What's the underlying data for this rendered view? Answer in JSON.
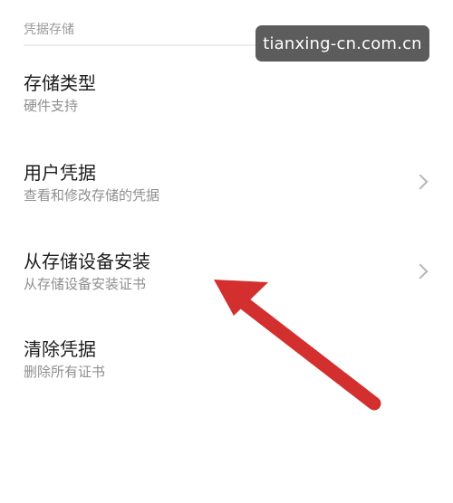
{
  "section": {
    "header": "凭据存储"
  },
  "rows": [
    {
      "title": "存储类型",
      "subtitle": "硬件支持",
      "has_chevron": false
    },
    {
      "title": "用户凭据",
      "subtitle": "查看和修改存储的凭据",
      "has_chevron": true
    },
    {
      "title": "从存储设备安装",
      "subtitle": "从存储设备安装证书",
      "has_chevron": true
    },
    {
      "title": "清除凭据",
      "subtitle": "删除所有证书",
      "has_chevron": false
    }
  ],
  "watermark": {
    "text": "tianxing-cn.com.cn"
  },
  "annotation": {
    "arrow_color": "#d32f2f",
    "icon": "red-arrow-icon"
  },
  "colors": {
    "title": "#1c1c1c",
    "subtitle": "#8f8f8f",
    "section_header": "#9a9a9a",
    "chevron": "#b5b5b5",
    "background": "#ffffff"
  }
}
